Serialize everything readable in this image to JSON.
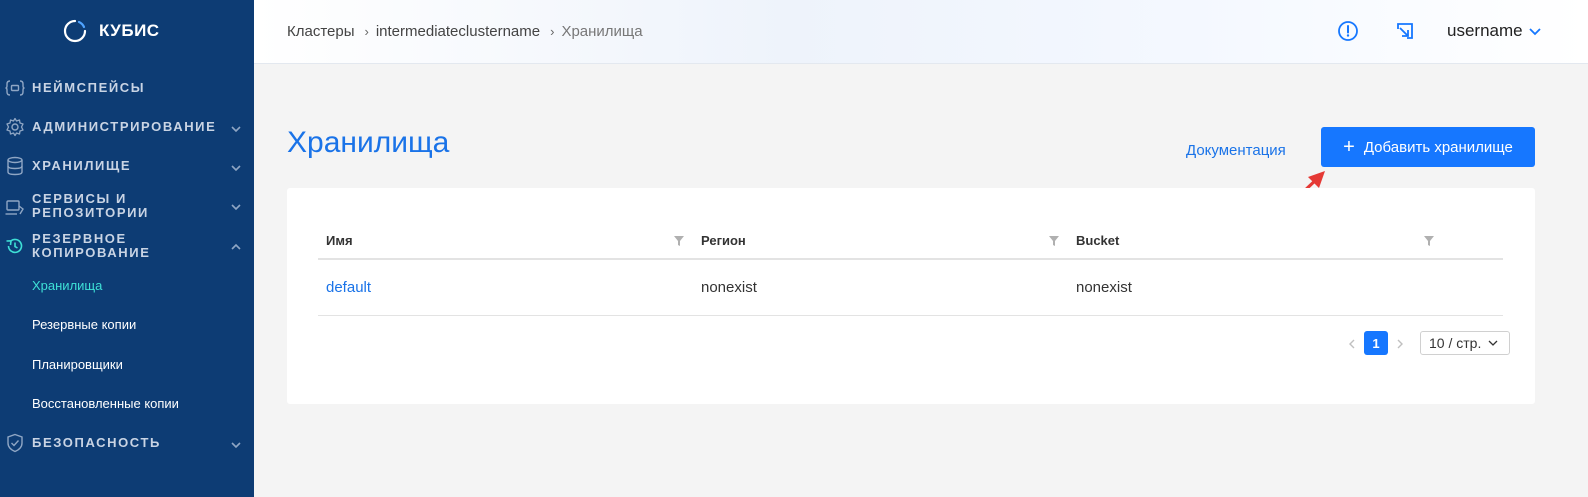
{
  "app": {
    "logo_text": "КУБИС"
  },
  "sidebar": {
    "items": [
      {
        "label": "НЕЙМСПЕЙСЫ",
        "icon": "namespace-icon"
      },
      {
        "label": "АДМИНИСТРИРОВАНИЕ",
        "icon": "gear-icon"
      },
      {
        "label": "ХРАНИЛИЩЕ",
        "icon": "database-icon"
      },
      {
        "label": "СЕРВИСЫ И\nРЕПОЗИТОРИИ",
        "icon": "services-icon"
      },
      {
        "label": "РЕЗЕРВНОЕ\nКОПИРОВАНИЕ",
        "icon": "backup-icon"
      },
      {
        "label": "БЕЗОПАСНОСТЬ",
        "icon": "shield-icon"
      }
    ],
    "backup_sub": [
      {
        "label": "Хранилища",
        "active": true
      },
      {
        "label": "Резервные копии"
      },
      {
        "label": "Планировщики"
      },
      {
        "label": "Восстановленные копии"
      }
    ]
  },
  "header": {
    "breadcrumb": [
      "Кластеры",
      "intermediateclustername",
      "Хранилища"
    ],
    "username": "username"
  },
  "main": {
    "title": "Хранилища",
    "doc_link": "Документация",
    "add_button": "Добавить хранилище",
    "table": {
      "columns": [
        "Имя",
        "Регион",
        "Bucket"
      ],
      "rows": [
        {
          "name": "default",
          "region": "nonexist",
          "bucket": "nonexist"
        }
      ]
    },
    "pagination": {
      "current_page": "1",
      "page_size": "10 / стр."
    }
  },
  "colors": {
    "sidebar_bg": "#0d3c74",
    "accent": "#1677ff",
    "active_sub": "#3ee0d6"
  }
}
